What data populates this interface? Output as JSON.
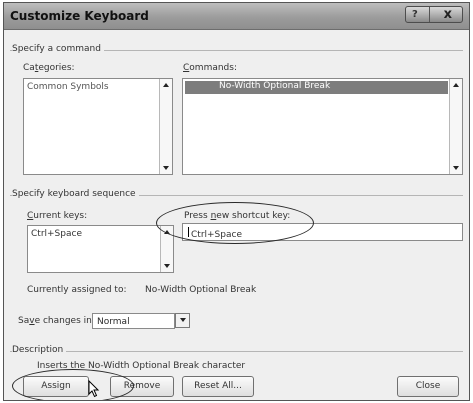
{
  "window": {
    "title": "Customize Keyboard",
    "help_glyph": "?",
    "close_glyph": "x"
  },
  "specify_command": {
    "group_label": "Specify a command",
    "categories_label": "Categories:",
    "categories_items": [
      "Common Symbols"
    ],
    "commands_label": "Commands:",
    "commands_items": [
      "No-Width Optional Break"
    ]
  },
  "keyboard_sequence": {
    "group_label": "Specify keyboard sequence",
    "current_keys_label": "Current keys:",
    "current_keys_items": [
      "Ctrl+Space"
    ],
    "new_shortcut_label": "Press new shortcut key:",
    "new_shortcut_value": "Ctrl+Space"
  },
  "assigned": {
    "label": "Currently assigned to:",
    "value": "No-Width Optional Break"
  },
  "save_changes": {
    "label": "Save changes in:",
    "value": "Normal"
  },
  "description": {
    "group_label": "Description",
    "text": "Inserts the No-Width Optional Break character"
  },
  "buttons": {
    "assign": "Assign",
    "remove": "Remove",
    "reset_all": "Reset All...",
    "close": "Close"
  }
}
